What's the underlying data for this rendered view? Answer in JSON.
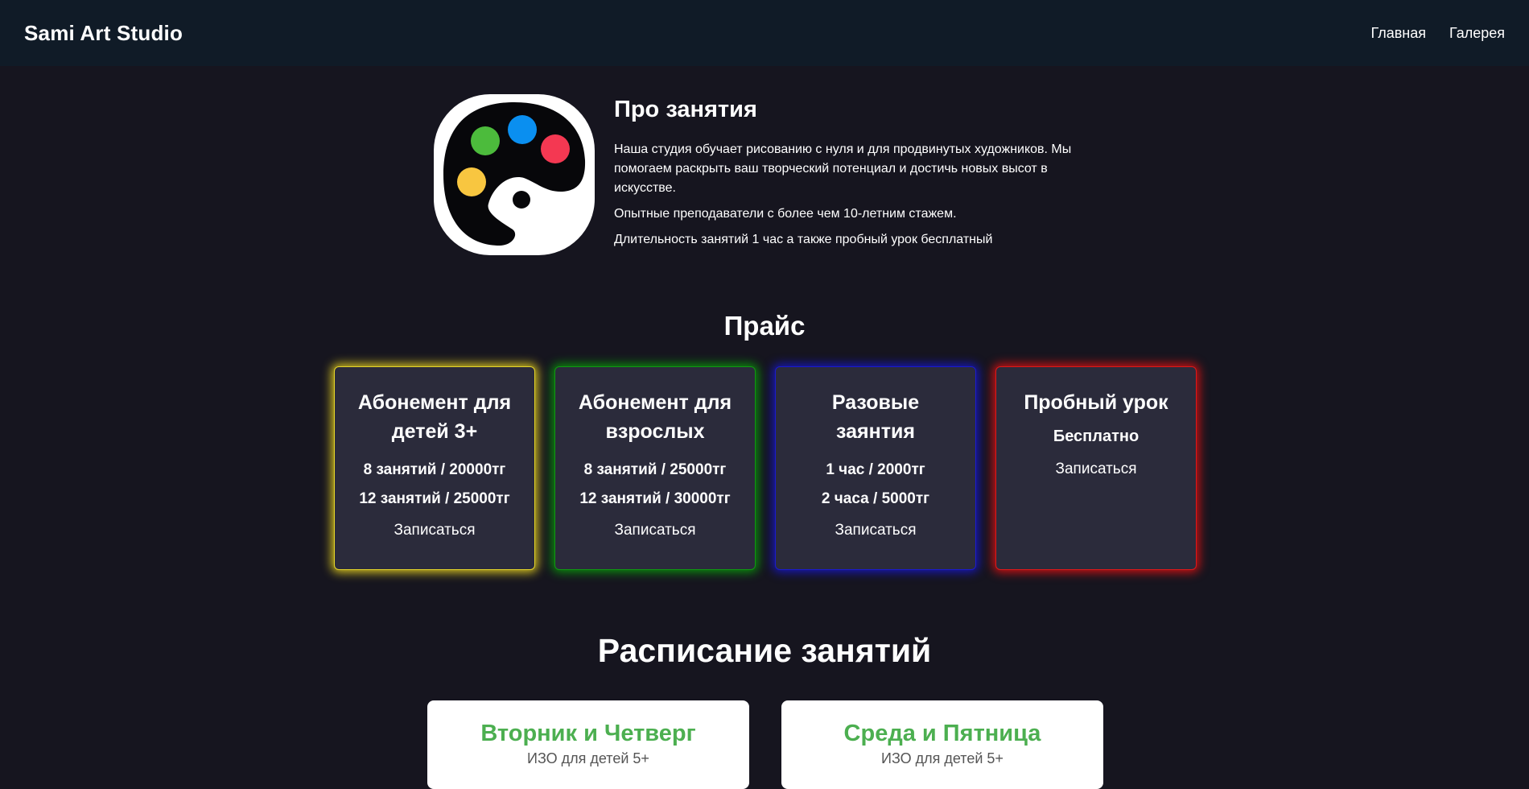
{
  "nav": {
    "brand": "Sami Art Studio",
    "links": [
      "Главная",
      "Галерея"
    ]
  },
  "about": {
    "title": "Про занятия",
    "paragraphs": [
      "Наша студия обучает рисованию с нуля и для продвинутых художников. Мы помогаем раскрыть ваш творческий потенциал и достичь новых высот в искусстве.",
      "Опытные преподаватели с более чем 10-летним стажем.",
      "Длительность занятий 1 час а также пробный урок бесплатный"
    ],
    "logo_icon": "palette-icon",
    "logo_colors": [
      "#4cbb3c",
      "#0a8ff0",
      "#f43852",
      "#f8c640"
    ]
  },
  "pricing": {
    "title": "Прайс",
    "cards": [
      {
        "title": "Абонемент для детей 3+",
        "lines": [
          "8 занятий / 20000тг",
          "12 занятий / 25000тг"
        ],
        "cta": "Записаться",
        "glow": "#d9c51f"
      },
      {
        "title": "Абонемент для взрослых",
        "lines": [
          "8 занятий / 25000тг",
          "12 занятий / 30000тг"
        ],
        "cta": "Записаться",
        "glow": "#0b8f0b"
      },
      {
        "title": "Разовые заянтия",
        "lines": [
          "1 час / 2000тг",
          "2 часа / 5000тг"
        ],
        "cta": "Записаться",
        "glow": "#1717b8"
      },
      {
        "title": "Пробный урок",
        "lines": [
          "Бесплатно"
        ],
        "cta": "Записаться",
        "glow": "#d01212"
      }
    ]
  },
  "schedule": {
    "title": "Расписание занятий",
    "cards": [
      {
        "days": "Вторник и Четверг",
        "subtitle": "ИЗО для детей 5+"
      },
      {
        "days": "Среда и Пятница",
        "subtitle": "ИЗО для детей 5+"
      }
    ],
    "accent": "#4caf50"
  }
}
